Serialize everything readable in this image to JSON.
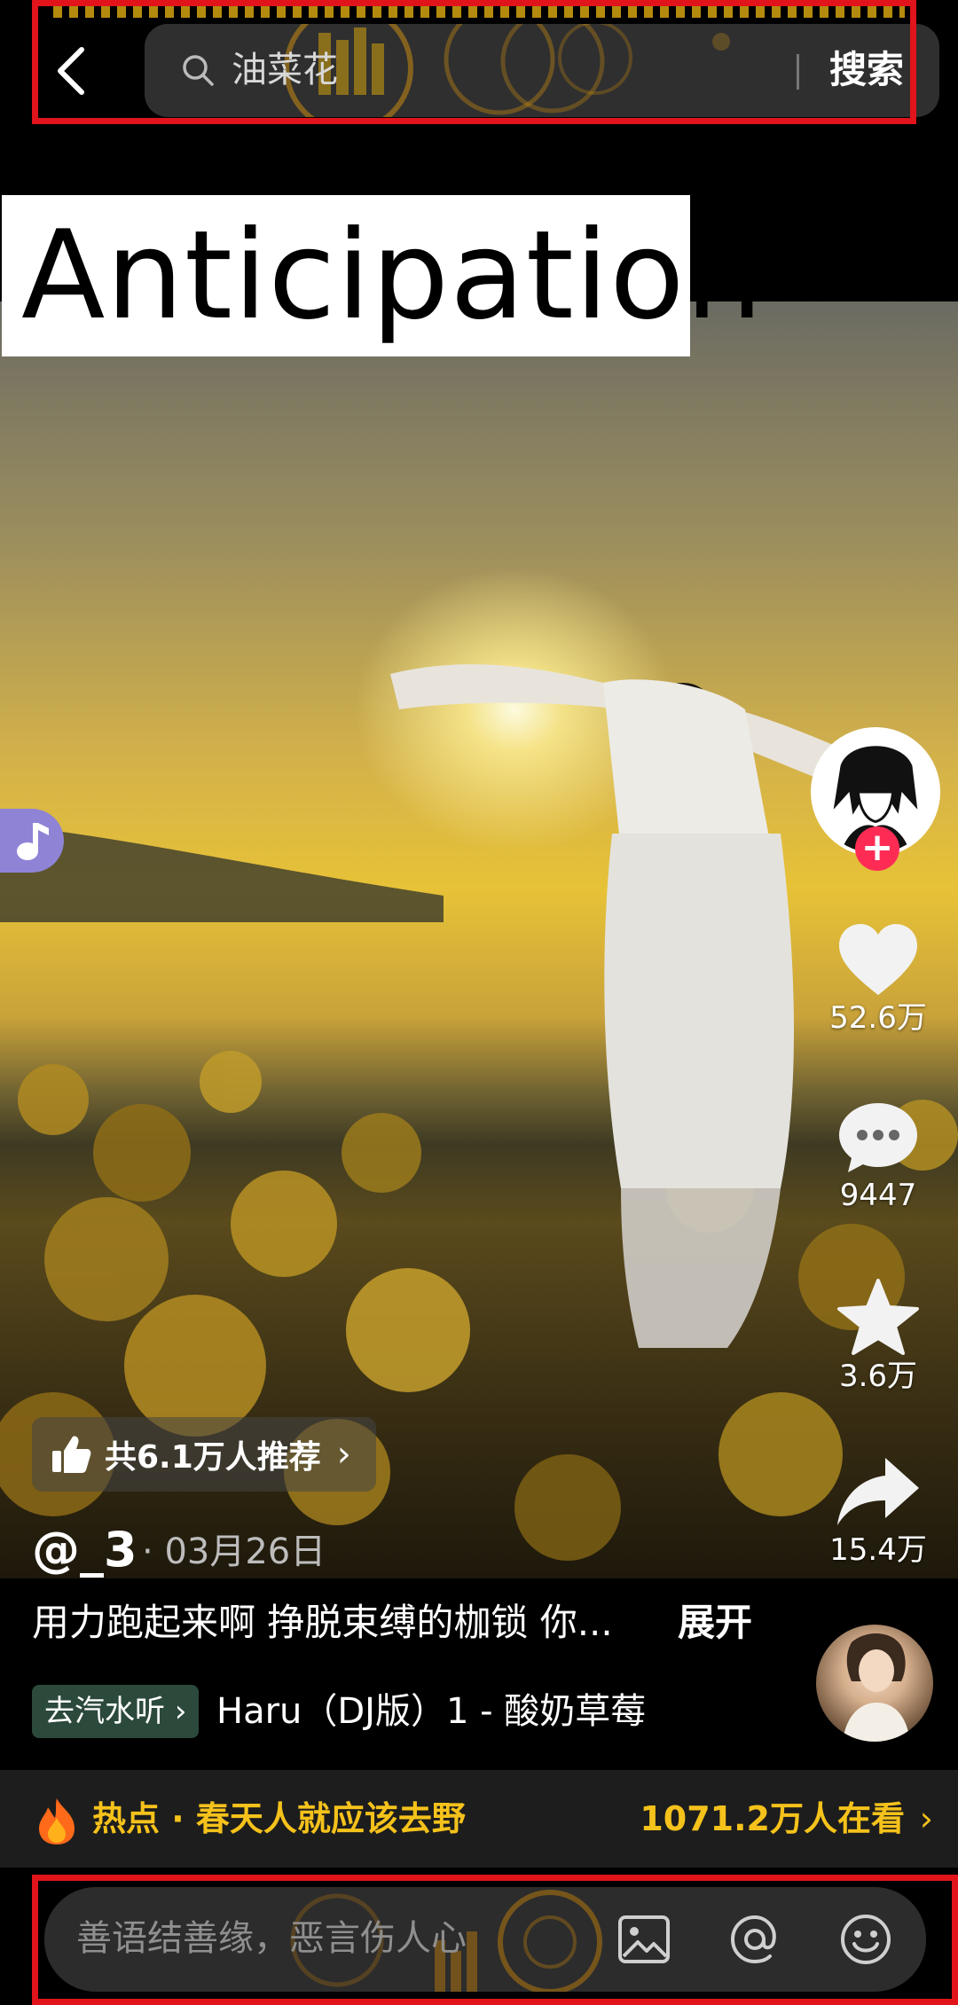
{
  "search": {
    "query": "油菜花",
    "submit_label": "搜索"
  },
  "overlay_label": "Anticipation",
  "video": {
    "recommend_text": "共6.1万人推荐",
    "author": "@_3",
    "date": "03月26日",
    "caption": "用力跑起来啊 挣脱束缚的枷锁 你...",
    "expand_label": "展开",
    "music_tag": "去汽水听",
    "music_title": "Haru（DJ版）1 - 酸奶草莓"
  },
  "actions": {
    "likes": "52.6万",
    "comments": "9447",
    "favorites": "3.6万",
    "shares": "15.4万"
  },
  "hot": {
    "label": "热点 · 春天人就应该去野",
    "watching": "1071.2万人在看"
  },
  "comment": {
    "placeholder": "善语结善缘，恶言伤人心"
  },
  "colors": {
    "accent_gold": "#f5c21b",
    "follow_red": "#fe2c55",
    "highlight_red": "#e0141a",
    "music_badge": "#8f83d6"
  },
  "icons": [
    "back-arrow-icon",
    "search-icon",
    "music-note-icon",
    "plus-icon",
    "heart-icon",
    "comment-bubble-icon",
    "star-icon",
    "share-arrow-icon",
    "thumbs-up-icon",
    "fire-icon",
    "image-icon",
    "at-icon",
    "emoji-icon"
  ]
}
